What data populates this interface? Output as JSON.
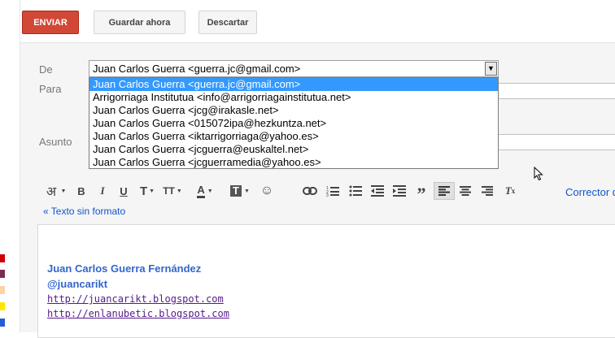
{
  "toolbar": {
    "send_label": "ENVIAR",
    "save_label": "Guardar ahora",
    "discard_label": "Descartar"
  },
  "form": {
    "from_label": "De",
    "to_label": "Para",
    "subject_label": "Asunto",
    "from_selected": "Juan Carlos Guerra <guerra.jc@gmail.com>",
    "from_options": [
      "Juan Carlos Guerra <guerra.jc@gmail.com>",
      "Arrigorriaga Institutua <info@arrigorriagainstitutua.net>",
      "Juan Carlos Guerra <jcg@irakasle.net>",
      "Juan Carlos Guerra <015072ipa@hezkuntza.net>",
      "Juan Carlos Guerra <iktarrigorriaga@yahoo.es>",
      "Juan Carlos Guerra <jcguerra@euskaltel.net>",
      "Juan Carlos Guerra <jcguerramedia@yahoo.es>"
    ]
  },
  "format": {
    "hindi_glyph": "अ",
    "spell_check": "Corrector d",
    "plain_text_link": "« Texto sin formato"
  },
  "signature": {
    "name": "Juan Carlos Guerra Fernández",
    "handle": "@juancarikt",
    "link1": "http://juancarikt.blogspot.com",
    "link2": "http://enlanubetic.blogspot.com"
  },
  "colors": {
    "send_button": "#d14836",
    "dropdown_highlight": "#3399ff",
    "link_blue": "#1155cc",
    "visited_link": "#551a8b"
  }
}
